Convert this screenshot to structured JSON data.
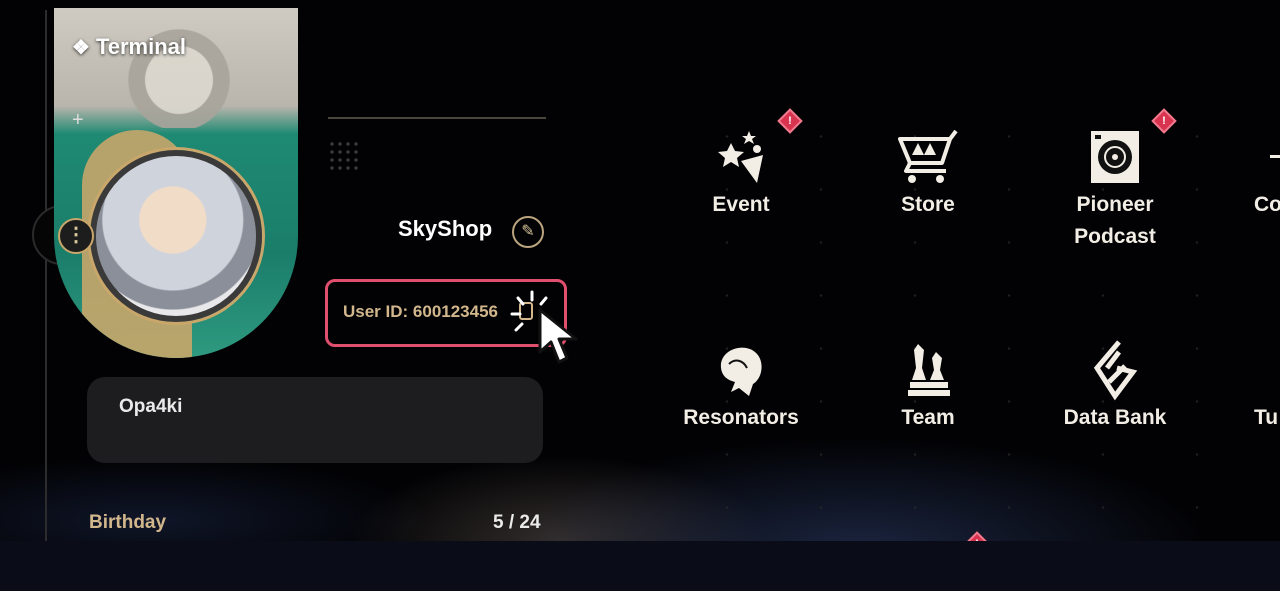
{
  "profile": {
    "card_title": "Terminal",
    "username": "SkyShop",
    "user_id": "User ID: 600123456",
    "signature": "Opa4ki",
    "birthday_label": "Birthday",
    "birthday_value": "5 / 24"
  },
  "menu": [
    {
      "label": "Event",
      "icon": "event-icon",
      "alert": true
    },
    {
      "label": "Store",
      "icon": "store-cart-icon",
      "alert": false
    },
    {
      "label": "Pioneer",
      "label2": "Podcast",
      "icon": "podcast-icon",
      "alert": true
    },
    {
      "label": "Co",
      "icon": "partial-icon",
      "alert": false
    },
    {
      "label": "Resonators",
      "icon": "resonators-icon",
      "alert": false
    },
    {
      "label": "Team",
      "icon": "team-icon",
      "alert": false
    },
    {
      "label": "Data Bank",
      "icon": "data-bank-icon",
      "alert": false
    },
    {
      "label": "Tu",
      "icon": "partial-icon",
      "alert": false
    }
  ],
  "badge_text": "!",
  "colors": {
    "highlight": "#e0506e",
    "gold_text": "#d2b78c",
    "alert_badge": "#d8344f"
  }
}
